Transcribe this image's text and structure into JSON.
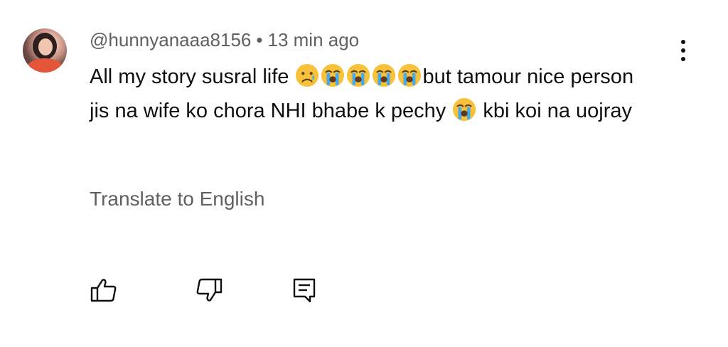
{
  "comment": {
    "author": "@hunnyanaaa8156",
    "separator": "•",
    "time": "13 min ago",
    "text_part1": "All my story susral life ",
    "text_part2": "but tamour nice person jis na wife ko chora NHI bhabe k pechy ",
    "text_part3": " kbi koi na uojray",
    "emojis_line1": [
      "sad-tear-face",
      "loudly-crying-face",
      "loudly-crying-face",
      "loudly-crying-face",
      "loudly-crying-face"
    ],
    "emojis_line2": [
      "loudly-crying-face"
    ],
    "translate_label": "Translate to English"
  },
  "actions": {
    "like_icon": "thumbs-up-icon",
    "dislike_icon": "thumbs-down-icon",
    "reply_icon": "reply-icon"
  },
  "menu": {
    "icon": "more-vertical-icon"
  },
  "colors": {
    "primary_text": "#0f0f0f",
    "secondary_text": "#606060",
    "emoji_face": "#f7c23a",
    "emoji_tears": "#49a8e8"
  }
}
